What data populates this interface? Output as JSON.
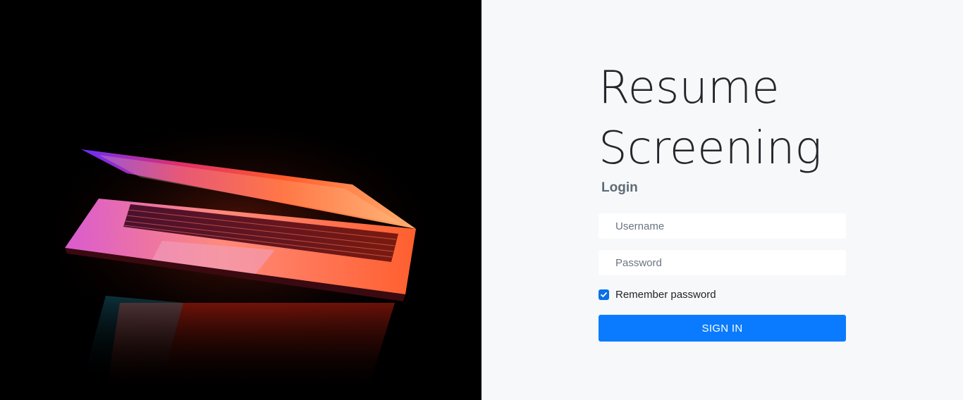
{
  "hero": {
    "image_subject": "laptop-glowing-keyboard"
  },
  "login": {
    "title": "Resume Screening",
    "subtitle": "Login",
    "username_placeholder": "Username",
    "password_placeholder": "Password",
    "remember_label": "Remember password",
    "remember_checked": true,
    "signin_label": "SIGN IN"
  },
  "colors": {
    "primary": "#0a7bff",
    "panel_bg": "#f7f8fa",
    "hero_bg": "#000000"
  }
}
